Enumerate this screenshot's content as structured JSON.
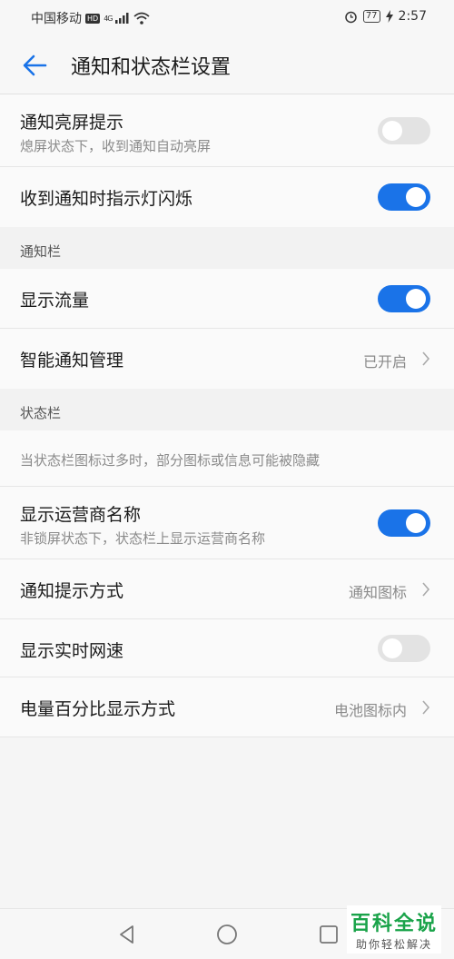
{
  "status_bar": {
    "carrier": "中国移动",
    "badge": "HD",
    "network": "4G",
    "battery": "77",
    "time": "2:57"
  },
  "header": {
    "title": "通知和状态栏设置"
  },
  "rows": {
    "wake_screen": {
      "title": "通知亮屏提示",
      "subtitle": "熄屏状态下，收到通知自动亮屏",
      "enabled": false
    },
    "led_blink": {
      "title": "收到通知时指示灯闪烁",
      "enabled": true
    },
    "show_traffic": {
      "title": "显示流量",
      "enabled": true
    },
    "smart_notify": {
      "title": "智能通知管理",
      "value": "已开启"
    },
    "hint": {
      "text": "当状态栏图标过多时，部分图标或信息可能被隐藏"
    },
    "carrier_name": {
      "title": "显示运营商名称",
      "subtitle": "非锁屏状态下，状态栏上显示运营商名称",
      "enabled": true
    },
    "notify_style": {
      "title": "通知提示方式",
      "value": "通知图标"
    },
    "net_speed": {
      "title": "显示实时网速",
      "enabled": false
    },
    "battery_pct": {
      "title": "电量百分比显示方式",
      "value": "电池图标内"
    }
  },
  "sections": {
    "notification_bar": "通知栏",
    "status_bar": "状态栏"
  },
  "watermark": {
    "main": "百科全说",
    "sub": "助你轻松解决"
  },
  "colors": {
    "accent": "#1a73e8",
    "toggle_off": "#e3e3e3",
    "watermark": "#1aa34a"
  }
}
